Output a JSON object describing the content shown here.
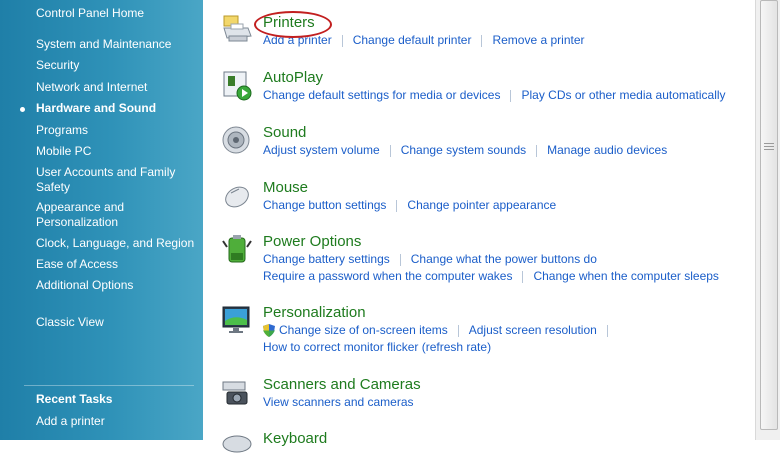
{
  "sidebar": {
    "home": "Control Panel Home",
    "items": [
      "System and Maintenance",
      "Security",
      "Network and Internet",
      "Hardware and Sound",
      "Programs",
      "Mobile PC",
      "User Accounts and Family Safety",
      "Appearance and Personalization",
      "Clock, Language, and Region",
      "Ease of Access",
      "Additional Options"
    ],
    "active_item": "Hardware and Sound",
    "classic_view": "Classic View",
    "recent_tasks_title": "Recent Tasks",
    "recent_tasks": [
      "Add a printer"
    ]
  },
  "categories": [
    {
      "title": "Printers",
      "icon": "printer-icon",
      "rows": [
        [
          "Add a printer",
          "Change default printer",
          "Remove a printer"
        ]
      ]
    },
    {
      "title": "AutoPlay",
      "icon": "autoplay-icon",
      "rows": [
        [
          "Change default settings for media or devices",
          "Play CDs or other media automatically"
        ]
      ]
    },
    {
      "title": "Sound",
      "icon": "speaker-icon",
      "rows": [
        [
          "Adjust system volume",
          "Change system sounds",
          "Manage audio devices"
        ]
      ]
    },
    {
      "title": "Mouse",
      "icon": "mouse-icon",
      "rows": [
        [
          "Change button settings",
          "Change pointer appearance"
        ]
      ]
    },
    {
      "title": "Power Options",
      "icon": "battery-icon",
      "rows": [
        [
          "Change battery settings",
          "Change what the power buttons do"
        ],
        [
          "Require a password when the computer wakes",
          "Change when the computer sleeps"
        ]
      ]
    },
    {
      "title": "Personalization",
      "icon": "monitor-icon",
      "rows": [
        [
          "Change size of on-screen items",
          "Adjust screen resolution"
        ],
        [
          "How to correct monitor flicker (refresh rate)"
        ]
      ]
    },
    {
      "title": "Scanners and Cameras",
      "icon": "camera-icon",
      "rows": [
        [
          "View scanners and cameras"
        ]
      ]
    },
    {
      "title": "Keyboard",
      "icon": "keyboard-icon",
      "rows": []
    }
  ],
  "colors": {
    "category_title": "#1e7b1e",
    "link": "#1b5ec9",
    "sidebar": "#2f92b8",
    "highlight": "#c21f1f"
  }
}
